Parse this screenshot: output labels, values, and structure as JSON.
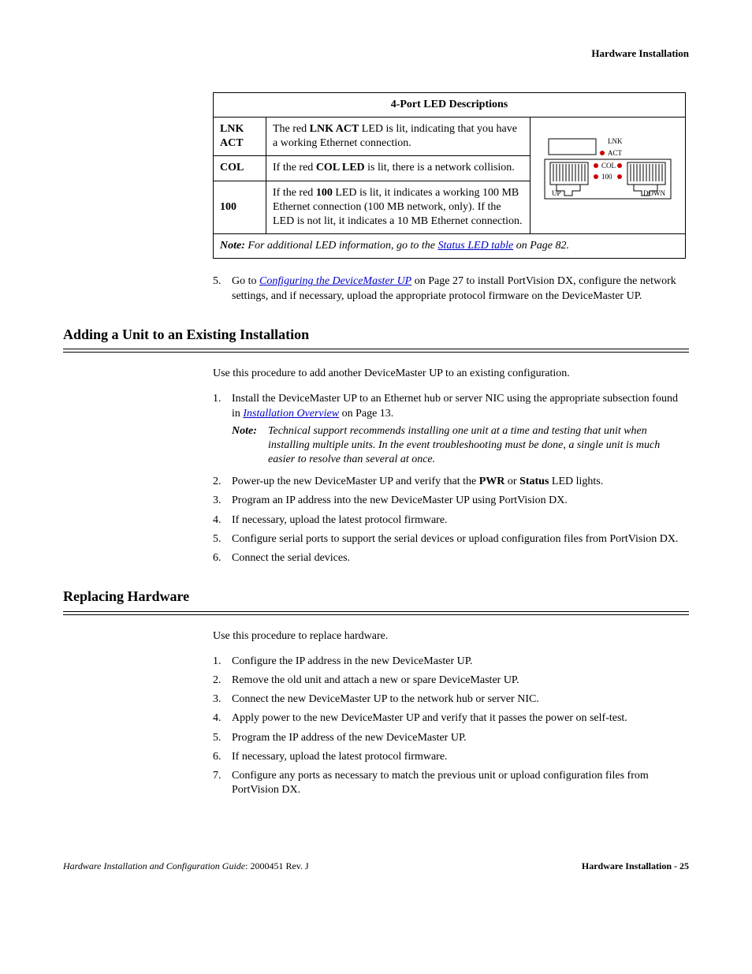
{
  "header": {
    "title": "Hardware Installation"
  },
  "table": {
    "title": "4-Port LED Descriptions",
    "rows": [
      {
        "label": "LNK ACT",
        "desc_pre": "The red ",
        "desc_bold": "LNK ACT",
        "desc_post": " LED is lit, indicating that you have a working Ethernet connection."
      },
      {
        "label": "COL",
        "desc_pre": "If the red ",
        "desc_bold": "COL LED",
        "desc_post": " is lit, there is a network collision."
      },
      {
        "label": "100",
        "desc_pre": "If the red ",
        "desc_bold": "100",
        "desc_post": " LED is lit, it indicates a working 100 MB Ethernet connection (100 MB network, only). If the LED is not lit, it indicates a 10 MB Ethernet connection."
      }
    ],
    "note_label": "Note:",
    "note_pre": "For additional LED information, go to the ",
    "note_link": "Status LED table",
    "note_post": " on Page 82.",
    "diagram": {
      "lnk": "LNK",
      "act": "ACT",
      "col": "COL",
      "hundred": "100",
      "up": "UP",
      "down": "DOWN"
    }
  },
  "step5": {
    "num": "5.",
    "pre": "Go to ",
    "link": "Configuring the DeviceMaster UP",
    "post": " on Page 27 to install PortVision DX, configure the network settings, and if necessary, upload the appropriate protocol firmware on the DeviceMaster UP."
  },
  "section_adding": {
    "heading": "Adding a Unit to an Existing Installation",
    "intro": "Use this procedure to add another DeviceMaster UP to an existing configuration.",
    "steps": [
      {
        "num": "1.",
        "text_pre": "Install the DeviceMaster UP to an Ethernet hub or server NIC using the appropriate subsection found in ",
        "link": "Installation Overview",
        "text_post": " on Page 13.",
        "note_label": "Note:",
        "note_text": "Technical support recommends installing one unit at a time and testing that unit when installing multiple units. In the event troubleshooting must be done, a single unit is much easier to resolve than several at once."
      },
      {
        "num": "2.",
        "text_pre": "Power-up the new DeviceMaster UP and verify that the ",
        "bold1": "PWR",
        "mid": " or ",
        "bold2": "Status",
        "text_post": " LED lights."
      },
      {
        "num": "3.",
        "text": "Program an IP address into the new DeviceMaster UP using PortVision DX."
      },
      {
        "num": "4.",
        "text": "If necessary, upload the latest protocol firmware."
      },
      {
        "num": "5.",
        "text": "Configure serial ports to support the serial devices or upload configuration files from PortVision DX."
      },
      {
        "num": "6.",
        "text": "Connect the serial devices."
      }
    ]
  },
  "section_replacing": {
    "heading": "Replacing Hardware",
    "intro": "Use this procedure to replace hardware.",
    "steps": [
      {
        "num": "1.",
        "text": "Configure the IP address in the new DeviceMaster UP."
      },
      {
        "num": "2.",
        "text": "Remove the old unit and attach a new or spare DeviceMaster UP."
      },
      {
        "num": "3.",
        "text": "Connect the new DeviceMaster UP to the network hub or server NIC."
      },
      {
        "num": "4.",
        "text": "Apply power to the new DeviceMaster UP and verify that it passes the power on self-test."
      },
      {
        "num": "5.",
        "text": "Program the IP address of the new DeviceMaster UP."
      },
      {
        "num": "6.",
        "text": "If necessary, upload the latest protocol firmware."
      },
      {
        "num": "7.",
        "text": "Configure any ports as necessary to match the previous unit or upload configuration files from PortVision DX."
      }
    ]
  },
  "footer": {
    "left_italic": "Hardware Installation and Configuration Guide",
    "left_rest": ": 2000451 Rev. J",
    "right": "Hardware Installation - 25"
  }
}
